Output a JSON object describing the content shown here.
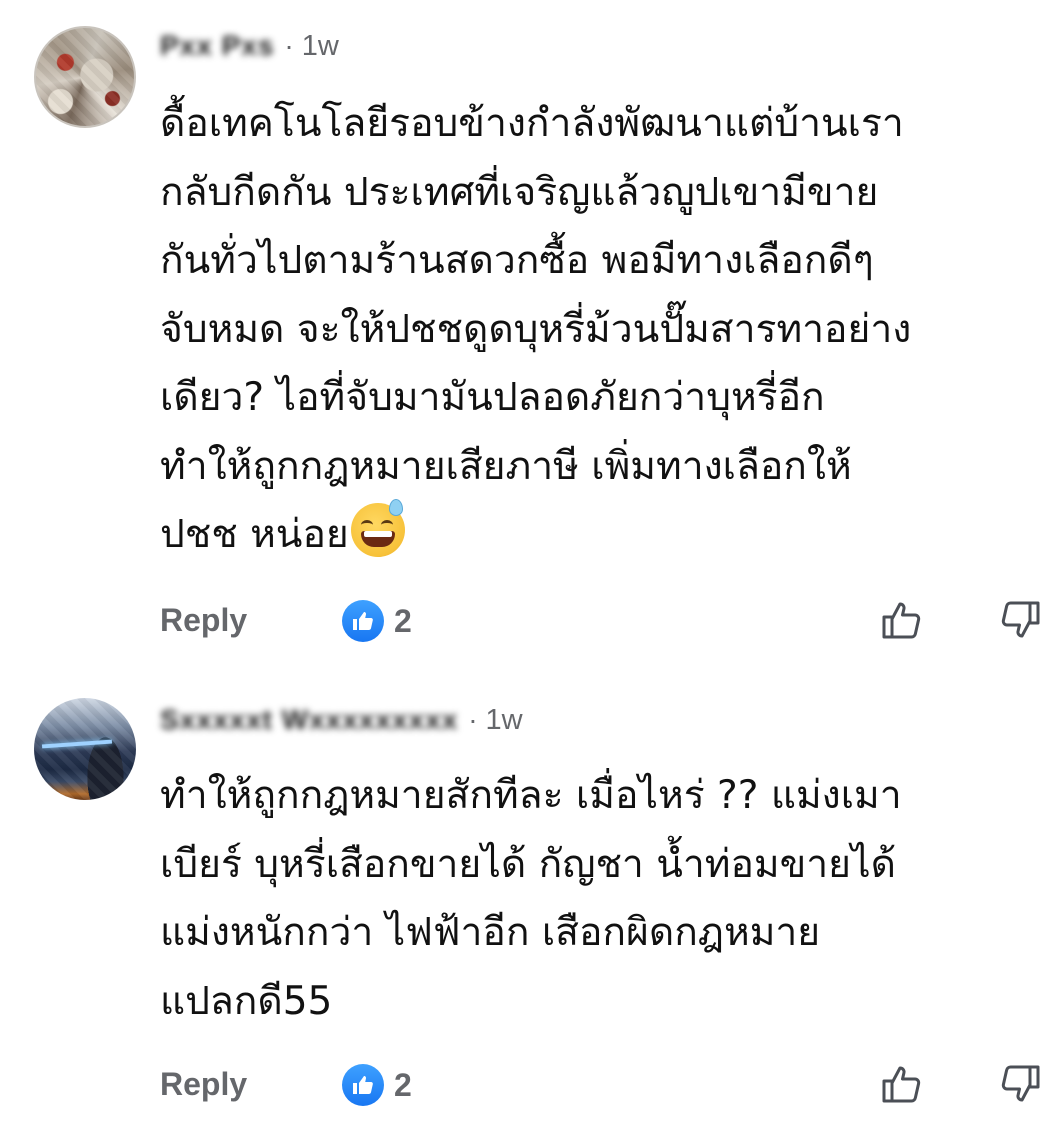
{
  "comments": [
    {
      "author": "Pxx Pxs",
      "time": "1w",
      "lines": [
        "ดื้อเทคโนโลยีรอบข้างกำลังพัฒนาแต่บ้านเรา",
        "กลับกีดกัน ประเทศที่เจริญแล้วญูปเขามีขาย",
        "กันทั่วไปตามร้านสดวกซื้อ พอมีทางเลือกดีๆ",
        "จับหมด จะให้ปชชดูดบุหรี่ม้วนปั๊มสารทาอย่าง",
        "เดียว? ไอที่จับมามันปลอดภัยกว่าบุหรี่อีก",
        "ทำให้ถูกกฎหมายเสียภาษี เพิ่มทางเลือกให้",
        "ปชช หน่อย"
      ],
      "emoji": "grinning-face-with-sweat",
      "reply_label": "Reply",
      "like_count": "2"
    },
    {
      "author": "Sxxxxxt Wxxxxxxxxx",
      "time": "1w",
      "lines": [
        "ทำให้ถูกกฎหมายสักทีละ เมื่อไหร่ ?? แม่งเมา",
        "เบียร์ บุหรี่เสือกขายได้ กัญชา น้ำท่อมขายได้",
        "แม่งหนักกว่า ไฟฟ้าอีก เสือกผิดกฎหมาย",
        "แปลกดี55"
      ],
      "reply_label": "Reply",
      "like_count": "2"
    }
  ],
  "colors": {
    "text": "#111111",
    "meta": "#65676b",
    "like_blue": "#1877f2"
  },
  "icons": {
    "like_badge": "like-badge-icon",
    "thumb_up": "thumbs-up-outline-icon",
    "thumb_down": "thumbs-down-outline-icon"
  }
}
